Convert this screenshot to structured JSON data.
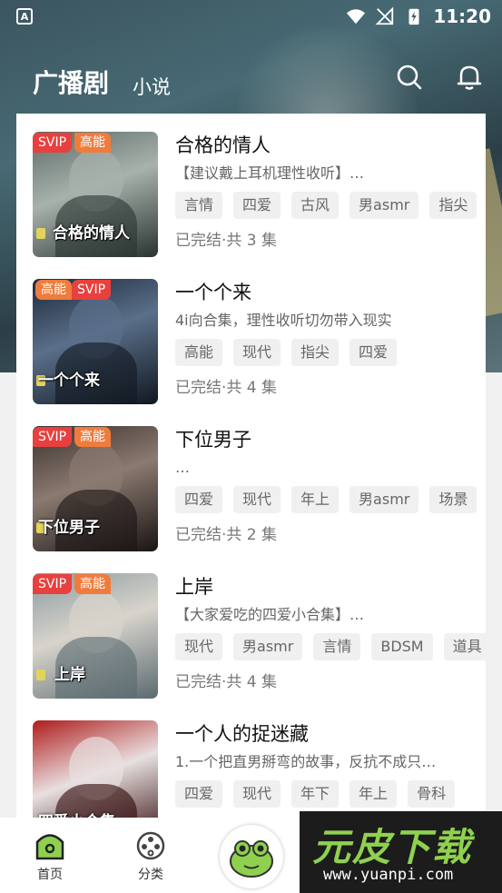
{
  "status_bar": {
    "time": "11:20",
    "left_badge": "A"
  },
  "nav": {
    "title": "广播剧",
    "tab": "小说"
  },
  "items": [
    {
      "cover_text": "合格的情人",
      "badges": [
        "SVIP",
        "高能"
      ],
      "title": "合格的情人",
      "desc": "【建议戴上耳机理性收听】…",
      "tags": [
        "言情",
        "四爱",
        "古风",
        "男asmr",
        "指尖"
      ],
      "status": "已完结·共 3 集",
      "cover_colors": [
        "#5a6a66",
        "#a8b2ac",
        "#2a3330"
      ]
    },
    {
      "cover_text": "一个个来",
      "badges": [
        "高能",
        "SVIP"
      ],
      "title": "一个个来",
      "desc": "4i向合集，理性收听切勿带入现实",
      "tags": [
        "高能",
        "现代",
        "指尖",
        "四爱"
      ],
      "status": "已完结·共 4 集",
      "cover_colors": [
        "#1d2a3a",
        "#5a6f8a",
        "#101820"
      ]
    },
    {
      "cover_text": "下位男子",
      "badges": [
        "SVIP",
        "高能"
      ],
      "title": "下位男子",
      "desc": "…",
      "tags": [
        "四爱",
        "现代",
        "年上",
        "男asmr",
        "场景"
      ],
      "status": "已完结·共 2 集",
      "cover_colors": [
        "#3a302e",
        "#8a7a70",
        "#1a1414"
      ]
    },
    {
      "cover_text": "上岸",
      "badges": [
        "SVIP",
        "高能"
      ],
      "title": "上岸",
      "desc": "【大家爱吃的四爱小合集】…",
      "tags": [
        "现代",
        "男asmr",
        "言情",
        "BDSM",
        "道具"
      ],
      "status": "已完结·共 4 集",
      "cover_colors": [
        "#8a9aa0",
        "#d8d4cc",
        "#5a6a70"
      ]
    },
    {
      "cover_text": "四爱小合集",
      "badges": [],
      "title": "一个人的捉迷藏",
      "desc": "1.一个把直男掰弯的故事，反抗不成只…",
      "tags": [
        "四爱",
        "现代",
        "年下",
        "年上",
        "骨科"
      ],
      "status": "",
      "cover_colors": [
        "#b01c1c",
        "#e8e0e0",
        "#300808"
      ]
    }
  ],
  "tabbar": {
    "home": "首页",
    "category": "分类"
  },
  "watermark": {
    "big": "元皮下载",
    "small": "www.yuanpi.com"
  }
}
